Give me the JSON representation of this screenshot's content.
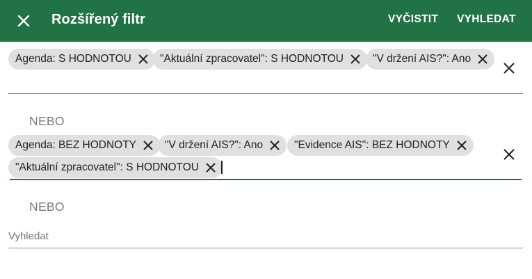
{
  "header": {
    "title": "Rozšířený filtr",
    "clear_label": "VYČISTIT",
    "search_label": "VYHLEDAT"
  },
  "groups": [
    {
      "chips": [
        {
          "label": "Agenda: S HODNOTOU"
        },
        {
          "label": "\"Aktuální zpracovatel\": S HODNOTOU"
        },
        {
          "label": "\"V držení AIS?\": Ano"
        }
      ]
    },
    {
      "separator": "NEBO",
      "chips": [
        {
          "label": "Agenda: BEZ HODNOTY"
        },
        {
          "label": "\"V držení AIS?\": Ano"
        },
        {
          "label": "\"Evidence AIS\": BEZ HODNOTY"
        },
        {
          "label": "\"Aktuální zpracovatel\": S HODNOTOU"
        }
      ]
    },
    {
      "separator": "NEBO",
      "input_placeholder": "Vyhledat",
      "input_value": ""
    }
  ],
  "icons": {
    "close": "close-icon",
    "chip_remove": "close-icon",
    "row_clear": "close-icon"
  },
  "colors": {
    "accent": "#217346",
    "chip_bg": "#e0e0e0",
    "separator_text": "#7a7a7a"
  }
}
